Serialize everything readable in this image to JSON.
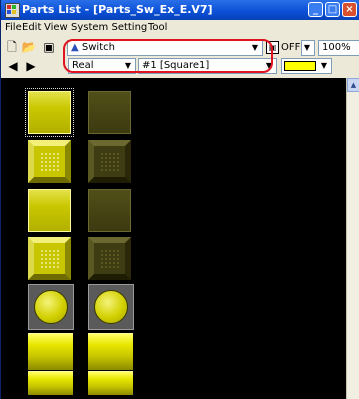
{
  "window": {
    "title": "Parts List - [Parts_Sw_Ex_E.V7]",
    "controls": [
      "minimize-icon",
      "maximize-icon",
      "close-icon"
    ]
  },
  "menu": [
    "File",
    "Edit",
    "View",
    "System Setting",
    "Tool"
  ],
  "toolbar": {
    "part_type": "Switch",
    "state_label": "OFF",
    "zoom": "100%",
    "category": "Real",
    "part_name": "#1 [Square1]",
    "color_swatch": "#ffff00"
  },
  "parts_grid": {
    "columns": 2,
    "rows": [
      "square-flat",
      "square-beveled",
      "square-flat",
      "square-beveled",
      "round",
      "cylinder",
      "cylinder"
    ]
  },
  "colors": {
    "title_bar": "#0a4fd6",
    "callout": "#e0141e",
    "canvas_bg": "#000000",
    "on_yellow": "#cccb00",
    "off_olive": "#45430f"
  }
}
